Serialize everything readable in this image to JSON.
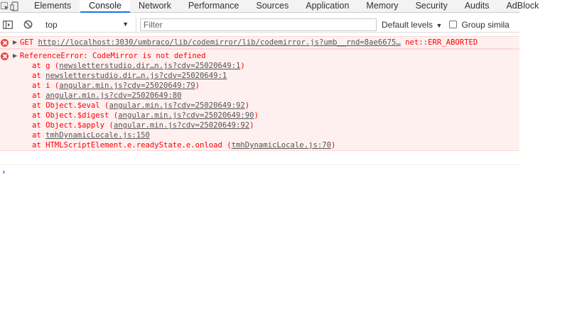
{
  "tabs": [
    "Elements",
    "Console",
    "Network",
    "Performance",
    "Sources",
    "Application",
    "Memory",
    "Security",
    "Audits",
    "AdBlock"
  ],
  "active_tab": "Console",
  "toolbar": {
    "context": "top",
    "filter_placeholder": "Filter",
    "levels": "Default levels",
    "group_label": "Group simila"
  },
  "messages": {
    "get": {
      "method": "GET",
      "url": "http://localhost:3030/umbraco/lib/codemirror/lib/codemirror.js?umb__rnd=8ae6675…",
      "status": "net::ERR_ABORTED"
    },
    "error": {
      "text": "ReferenceError: CodeMirror is not defined",
      "stack": [
        {
          "prefix": "at g (",
          "link": "newsletterstudio.dir…n.js?cdv=25020649:1",
          "suffix": ")"
        },
        {
          "prefix": "",
          "link": "newsletterstudio.dir…n.js?cdv=25020649:1",
          "suffix": ""
        },
        {
          "prefix": "at i (",
          "link": "angular.min.js?cdv=25020649:79",
          "suffix": ")"
        },
        {
          "prefix": "",
          "link": "angular.min.js?cdv=25020649:80",
          "suffix": ""
        },
        {
          "prefix": "at Object.$eval (",
          "link": "angular.min.js?cdv=25020649:92",
          "suffix": ")"
        },
        {
          "prefix": "at Object.$digest (",
          "link": "angular.min.js?cdv=25020649:90",
          "suffix": ")"
        },
        {
          "prefix": "at Object.$apply (",
          "link": "angular.min.js?cdv=25020649:92",
          "suffix": ")"
        },
        {
          "prefix": "at ",
          "link": "tmhDynamicLocale.js:150",
          "suffix": ""
        },
        {
          "prefix": "at HTMLScriptElement.e.readyState.e.onload (",
          "link": "tmhDynamicLocale.js:70",
          "suffix": ")"
        }
      ],
      "at_word": "at"
    }
  },
  "colors": {
    "error_text": "#ff0000",
    "error_bg": "#fff0f0",
    "accent": "#1a73e8"
  },
  "icons": [
    "inspect-icon",
    "device-toggle-icon",
    "sidebar-toggle-icon",
    "clear-console-icon",
    "dropdown-arrow-icon",
    "error-icon",
    "expand-triangle-icon",
    "console-prompt-icon"
  ]
}
